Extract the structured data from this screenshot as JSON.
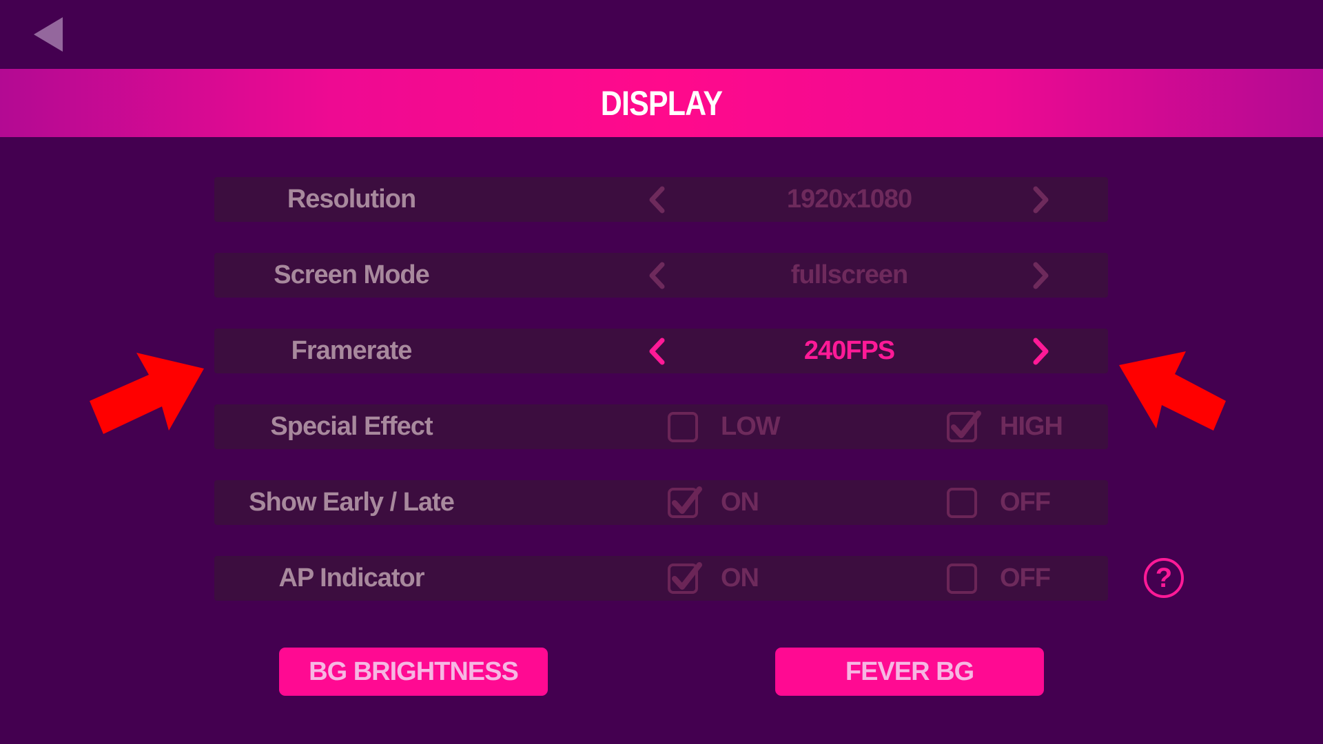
{
  "header": {
    "title": "DISPLAY"
  },
  "settings": [
    {
      "label": "Resolution",
      "value": "1920x1080",
      "state": "dim"
    },
    {
      "label": "Screen Mode",
      "value": "fullscreen",
      "state": "dim"
    },
    {
      "label": "Framerate",
      "value": "240FPS",
      "state": "active"
    },
    {
      "label": "Special Effect",
      "options": [
        {
          "label": "LOW",
          "checked": false
        },
        {
          "label": "HIGH",
          "checked": true
        }
      ]
    },
    {
      "label": "Show Early / Late",
      "options": [
        {
          "label": "ON",
          "checked": true
        },
        {
          "label": "OFF",
          "checked": false
        }
      ]
    },
    {
      "label": "AP Indicator",
      "options": [
        {
          "label": "ON",
          "checked": true
        },
        {
          "label": "OFF",
          "checked": false
        }
      ]
    }
  ],
  "help": {
    "icon": "question-icon",
    "glyph": "?"
  },
  "buttons": {
    "bg_brightness": "BG BRIGHTNESS",
    "fever_bg": "FEVER BG"
  },
  "icons": {
    "back": "back-triangle-icon",
    "arrows": "chevron-left-icon / chevron-right-icon"
  },
  "colors": {
    "background": "#440050",
    "header": "#ff0a8c",
    "row": "#3c0d3f",
    "label": "#a8899d",
    "dim_value": "#6e2a5c",
    "accent": "#ff1a97",
    "annotation_arrow": "#ff0000"
  }
}
